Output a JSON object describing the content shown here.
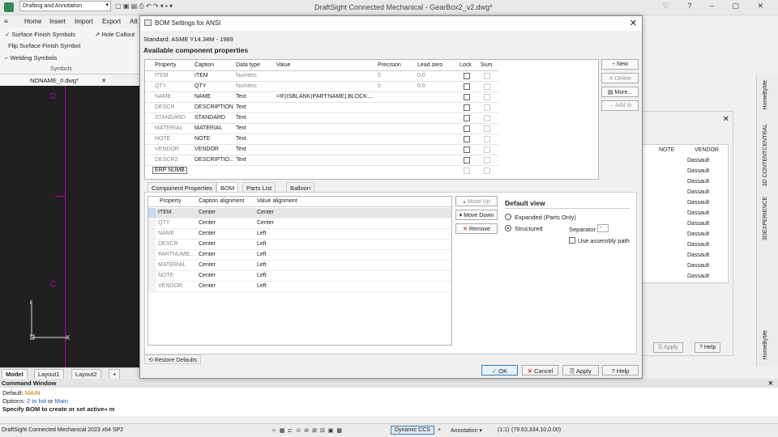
{
  "app": {
    "title": "DraftSight Connected Mechanical - GearBox2_v2.dwg*",
    "workspace": "Drafting and Annotation",
    "menu": [
      "Home",
      "Insert",
      "Import",
      "Export",
      "Att"
    ]
  },
  "ribbon": {
    "items": [
      "Surface Finish Symbols",
      "Hole Callout",
      "Flip Surface Finish Symbol",
      "Welding Symbols"
    ],
    "group": "Symbols"
  },
  "doc_tab": "NONAME_0.dwg*",
  "drawing_labels": {
    "d": "D",
    "c": "C"
  },
  "layout_tabs": [
    "Model",
    "Layout1",
    "Layout2"
  ],
  "command_window": {
    "title": "Command Window",
    "default_label": "Default: ",
    "default_value": "MAIN",
    "options_label": "Options: ",
    "opt1": "2 to list",
    "opt_or": " or ",
    "opt2": "Main",
    "prompt": "Specify BOM to create or set active» m"
  },
  "status": {
    "product": "DraftSight Connected Mechanical 2023  x64 SP2",
    "ccs": "Dynamic CCS",
    "annotation": "Annotation",
    "scale": "(1:1)",
    "coords": "(79.63,334.10,0.00)"
  },
  "side_tabs": [
    "HomeByMe",
    "3D CONTENTCENTRAL",
    "3DEXPERIENCE",
    "HomeByMe"
  ],
  "bg_dialog": {
    "headers": [
      "NOTE",
      "VENDOR"
    ],
    "vendor_values": [
      "Dassault",
      "Dassault",
      "Dassault",
      "Dassault",
      "Dassault",
      "Dassault",
      "Dassault",
      "Dassault",
      "Dassault",
      "Dassault",
      "Dassault",
      "Dassault"
    ],
    "apply": "Apply",
    "help": "Help"
  },
  "dialog": {
    "title": "BOM Settings for ANSI",
    "standard": "Standard:  ASME Y14.34M - 1989",
    "section": "Available component properties",
    "headers": [
      "Property",
      "Caption",
      "Data type",
      "Value",
      "Precision",
      "Lead zero",
      "Lock",
      "Sum"
    ],
    "rows": [
      {
        "property": "ITEM",
        "caption": "ITEM",
        "type": "Numeric",
        "value": "",
        "precision": "0",
        "lead": "0.0"
      },
      {
        "property": "QTY",
        "caption": "QTY",
        "type": "Numeric",
        "value": "",
        "precision": "0",
        "lead": "0.0"
      },
      {
        "property": "NAME",
        "caption": "NAME",
        "type": "Text",
        "value": "=IF(ISBLANK(PART:NAME),BLOCK:...",
        "precision": "",
        "lead": ""
      },
      {
        "property": "DESCR",
        "caption": "DESCRIPTION",
        "type": "Text",
        "value": "",
        "precision": "",
        "lead": ""
      },
      {
        "property": "STANDARD",
        "caption": "STANDARD",
        "type": "Text",
        "value": "",
        "precision": "",
        "lead": ""
      },
      {
        "property": "MATERIAL",
        "caption": "MATERIAL",
        "type": "Text",
        "value": "",
        "precision": "",
        "lead": ""
      },
      {
        "property": "NOTE",
        "caption": "NOTE",
        "type": "Text",
        "value": "",
        "precision": "",
        "lead": ""
      },
      {
        "property": "VENDOR",
        "caption": "VENDOR",
        "type": "Text",
        "value": "",
        "precision": "",
        "lead": ""
      },
      {
        "property": "DESCR2",
        "caption": "DESCRIPTIO...",
        "type": "Text",
        "value": "",
        "precision": "",
        "lead": ""
      }
    ],
    "editing_value": "ERP NUMB",
    "side_buttons": {
      "new": "New",
      "delete": "Delete",
      "more": "More...",
      "add": "Add to"
    },
    "tabs": [
      "Component Properties",
      "BOM",
      "Parts List",
      "Balloon"
    ],
    "bom_headers": [
      "Property",
      "Caption alignment",
      "Value alignment"
    ],
    "bom_rows": [
      {
        "property": "ITEM",
        "caption": "Center",
        "value": "Center"
      },
      {
        "property": "QTY",
        "caption": "Center",
        "value": "Center"
      },
      {
        "property": "NAME",
        "caption": "Center",
        "value": "Left"
      },
      {
        "property": "DESCR",
        "caption": "Center",
        "value": "Left"
      },
      {
        "property": "PARTNUMB...",
        "caption": "Center",
        "value": "Left"
      },
      {
        "property": "MATERIAL",
        "caption": "Center",
        "value": "Left"
      },
      {
        "property": "NOTE",
        "caption": "Center",
        "value": "Left"
      },
      {
        "property": "VENDOR",
        "caption": "Center",
        "value": "Left"
      }
    ],
    "move_up": "Move Up",
    "move_down": "Move Down",
    "remove": "Remove",
    "default_view": "Default view",
    "expanded": "Expanded (Parts Only)",
    "structured": "Structured",
    "separator_label": "Separator",
    "separator_value": "-",
    "use_assembly_path": "Use assembly path",
    "restore": "Restore Defaults",
    "ok": "OK",
    "cancel": "Cancel",
    "apply": "Apply",
    "help": "Help"
  }
}
